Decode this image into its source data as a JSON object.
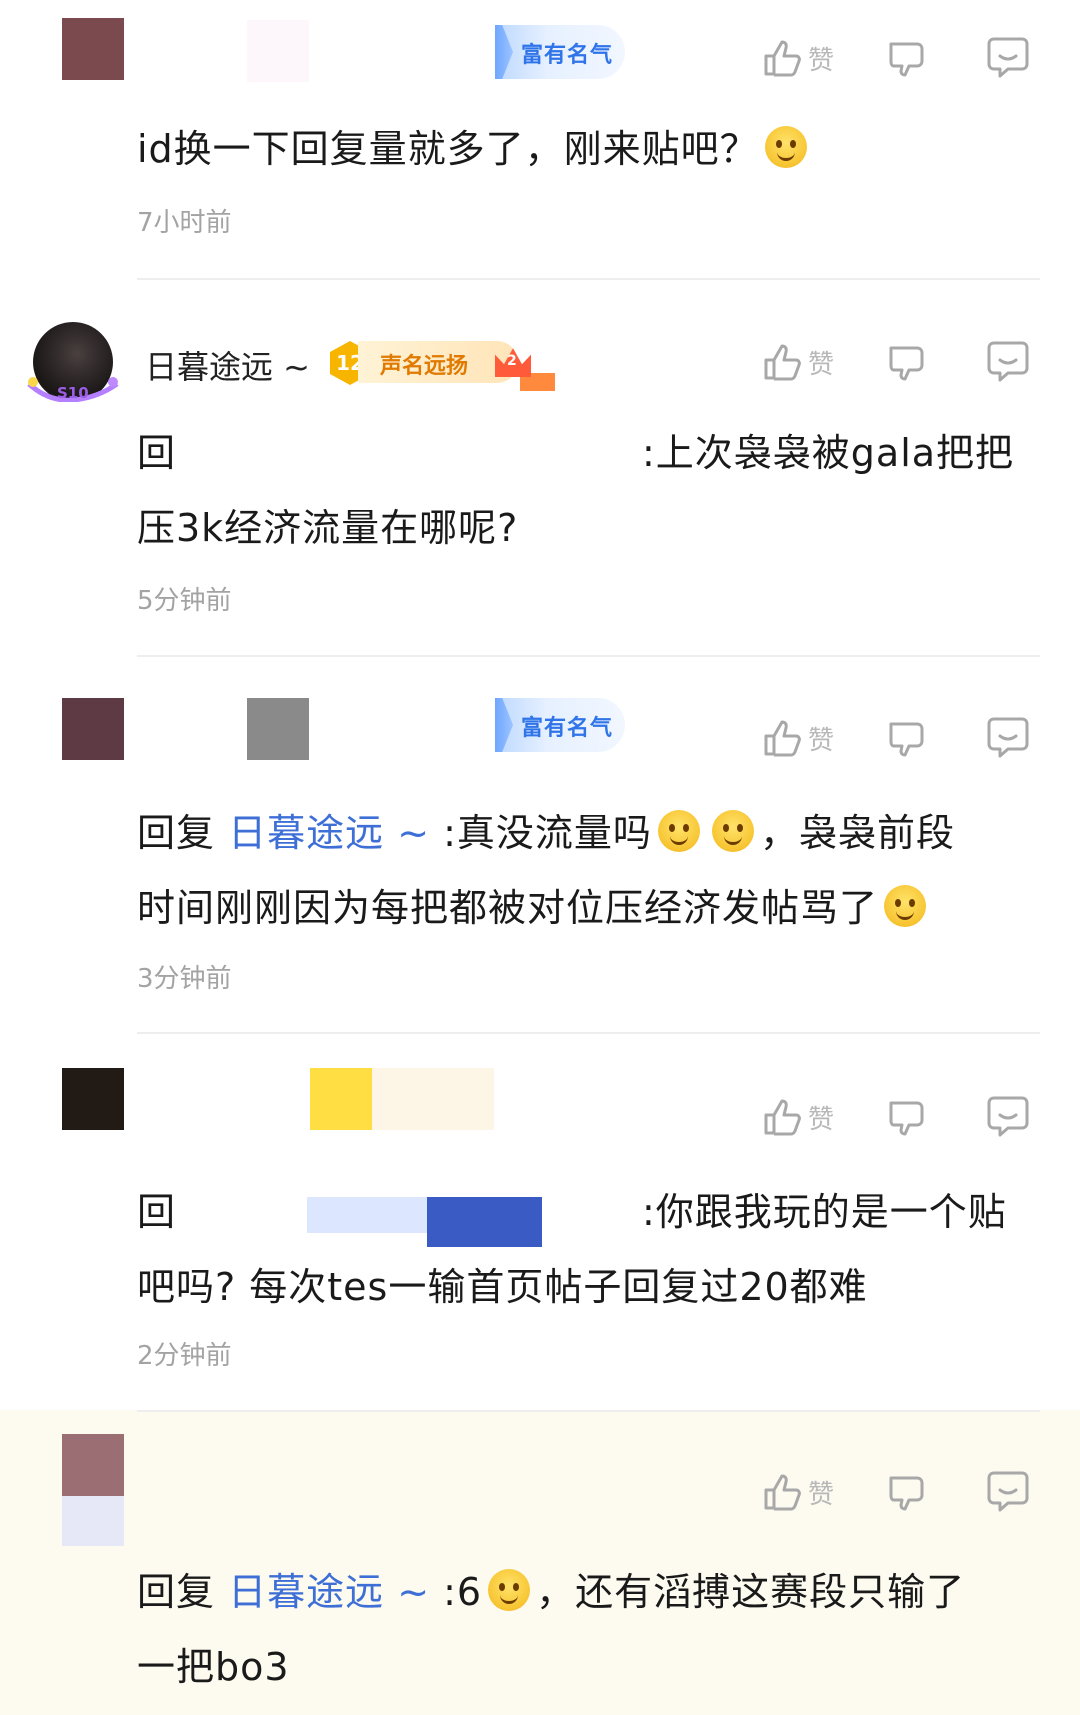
{
  "comments": [
    {
      "badge": "富有名气",
      "text": "id换一下回复量就多了，刚来贴吧？",
      "time": "7小时前",
      "like_label": "赞"
    },
    {
      "username": "日暮途远 ~",
      "level": "12",
      "badge": "声名远扬",
      "crown_number": "2",
      "avatar_tag": "S10",
      "text_prefix": "回",
      "text_part1": ":上次袅袅被gala把把",
      "text_part2": "压3k经济流量在哪呢?",
      "time": "5分钟前",
      "like_label": "赞"
    },
    {
      "badge": "富有名气",
      "reply_word": "回复",
      "mention": "日暮途远 ~",
      "text_part1": ":真没流量吗",
      "text_part2": "，袅袅前段",
      "text_line2": "时间刚刚因为每把都被对位压经济发帖骂了",
      "time": "3分钟前",
      "like_label": "赞"
    },
    {
      "text_prefix": "回",
      "text_part1": ":你跟我玩的是一个贴",
      "text_line2": "吧吗? 每次tes一输首页帖子回复过20都难",
      "time": "2分钟前",
      "like_label": "赞"
    },
    {
      "reply_word": "回复",
      "mention": "日暮途远 ~",
      "text_part1": ":6",
      "text_part2": "，还有滔搏这赛段只输了",
      "text_line2": "一把bo3",
      "like_label": "赞"
    }
  ],
  "colors": {
    "mention": "#3d6fd6",
    "time": "#a3a3a3",
    "badge_blue": "#2f74e8",
    "badge_orange": "#e07a00",
    "highlight_background": "#fdfaf0"
  },
  "icons": [
    "thumbs-up-icon",
    "thumbs-down-icon",
    "reply-bubble-icon",
    "smile-emoji-icon"
  ]
}
